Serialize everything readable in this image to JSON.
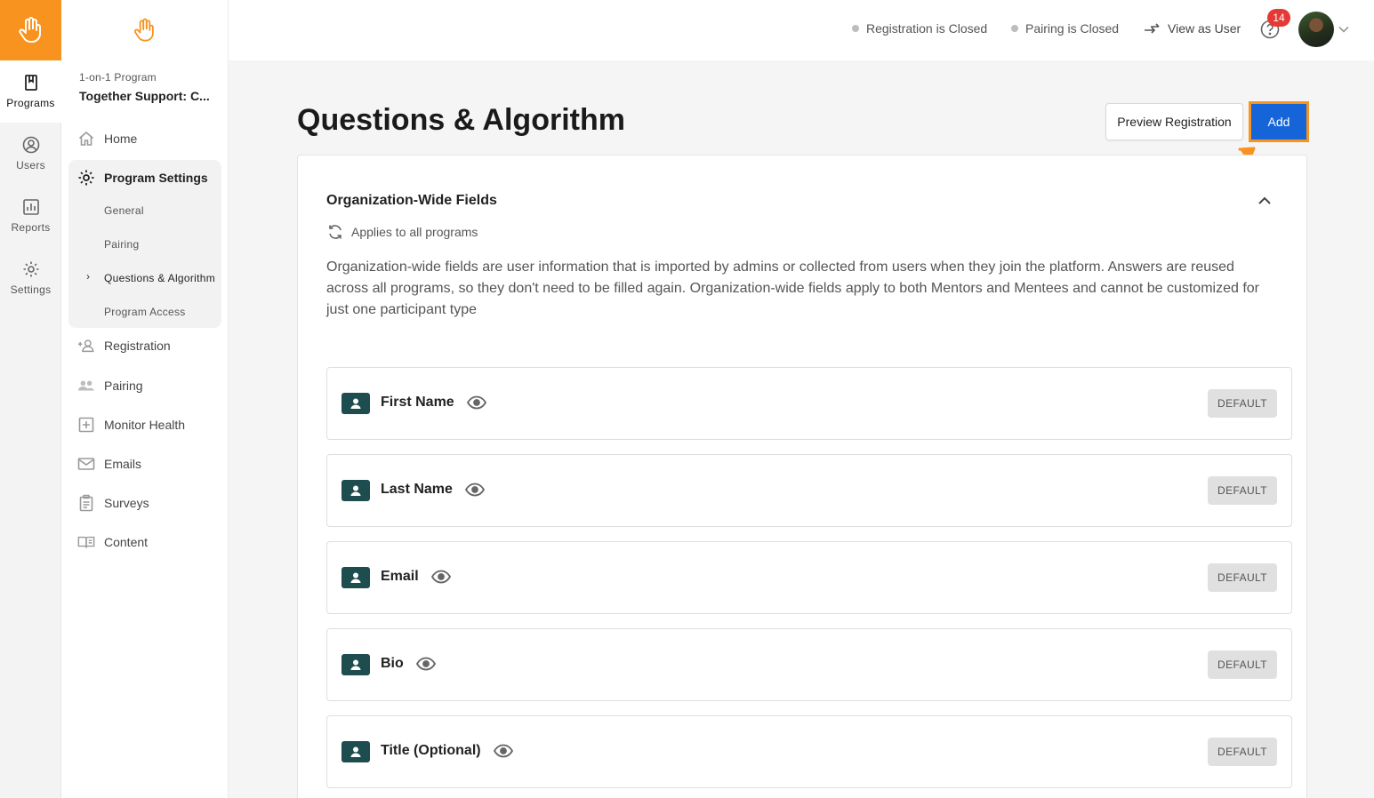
{
  "rail": {
    "items": [
      {
        "label": "Programs",
        "icon": "book-icon",
        "active": true
      },
      {
        "label": "Users",
        "icon": "user-circle-icon",
        "active": false
      },
      {
        "label": "Reports",
        "icon": "bar-chart-icon",
        "active": false
      },
      {
        "label": "Settings",
        "icon": "gear-icon",
        "active": false
      }
    ]
  },
  "sidebar": {
    "program_type": "1-on-1 Program",
    "program_name": "Together Support: C...",
    "home": "Home",
    "program_settings": "Program Settings",
    "sub_items": [
      "General",
      "Pairing",
      "Questions & Algorithm",
      "Program Access"
    ],
    "active_sub": "Questions & Algorithm",
    "items": [
      "Registration",
      "Pairing",
      "Monitor Health",
      "Emails",
      "Surveys",
      "Content"
    ]
  },
  "header": {
    "registration_status": "Registration is Closed",
    "pairing_status": "Pairing is Closed",
    "view_as_user": "View as User",
    "notification_count": "14"
  },
  "page": {
    "title": "Questions & Algorithm",
    "preview_button": "Preview Registration",
    "add_button": "Add"
  },
  "panel": {
    "title": "Organization-Wide Fields",
    "applies": "Applies to all programs",
    "description": "Organization-wide fields are user information that is imported by admins or collected from users when they join the platform. Answers are reused across all programs, so they don't need to be filled again. Organization-wide fields apply to both Mentors and Mentees and cannot be customized for just one participant type",
    "fields": [
      {
        "name": "First Name",
        "tag": "DEFAULT"
      },
      {
        "name": "Last Name",
        "tag": "DEFAULT"
      },
      {
        "name": "Email",
        "tag": "DEFAULT"
      },
      {
        "name": "Bio",
        "tag": "DEFAULT"
      },
      {
        "name": "Title (Optional)",
        "tag": "DEFAULT"
      }
    ]
  },
  "colors": {
    "brand_orange": "#f7931e",
    "primary_blue": "#1565d8",
    "field_icon_bg": "#1e4d4f",
    "badge_red": "#e53935"
  }
}
